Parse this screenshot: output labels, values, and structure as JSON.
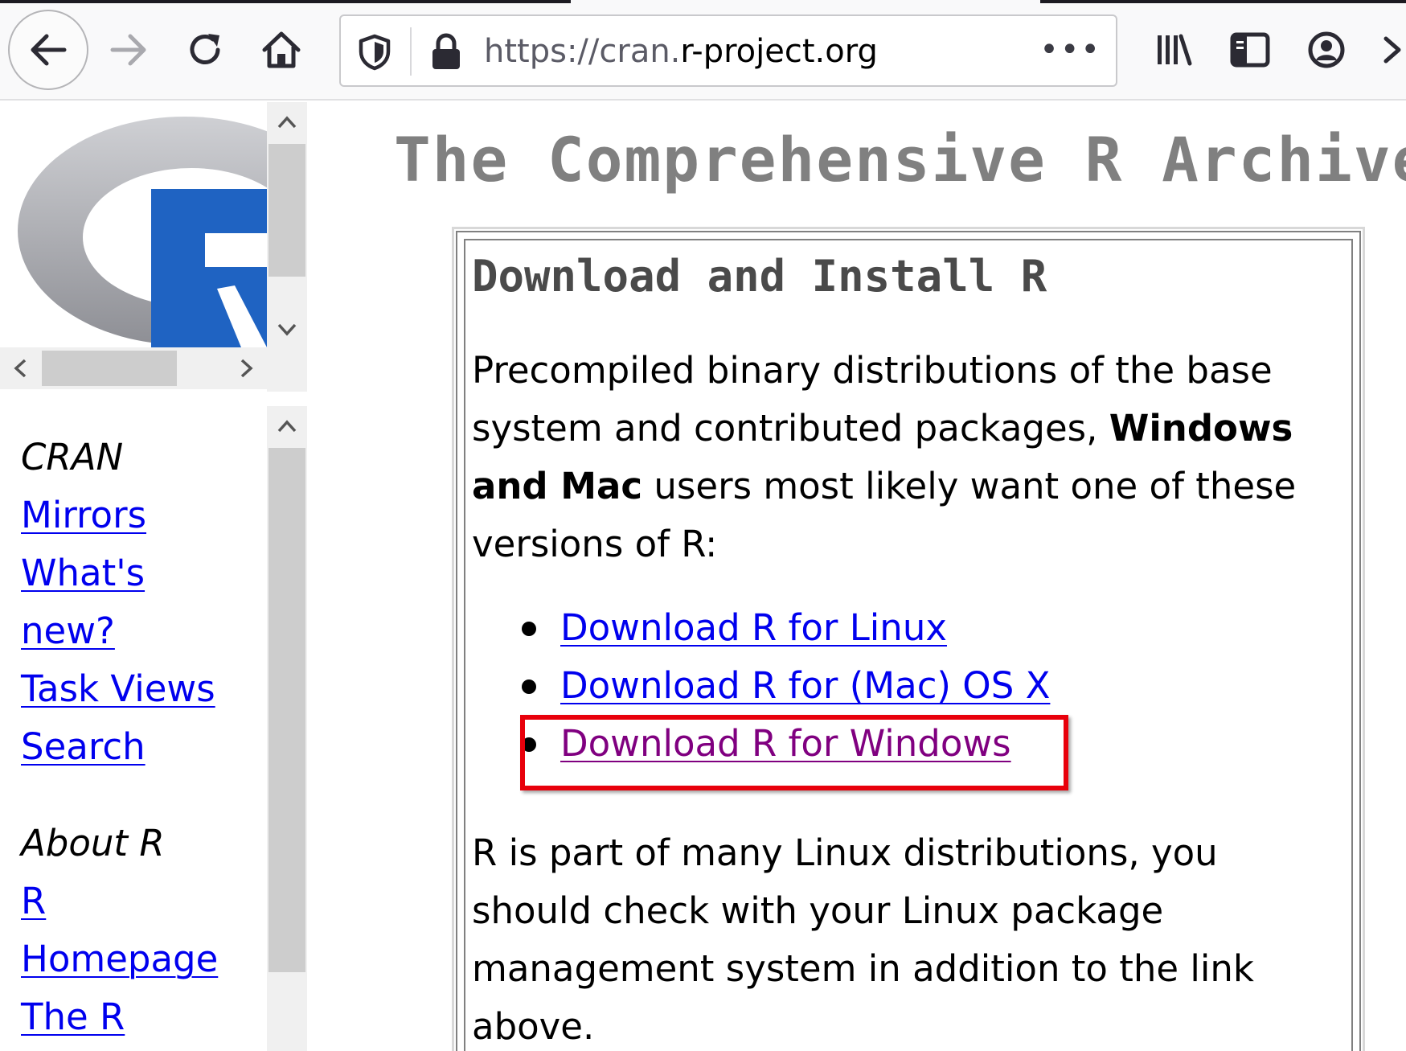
{
  "browser": {
    "url_prefix": "https://cran.",
    "url_domain": "r-project.org",
    "more_label": "•••"
  },
  "icons": {
    "back": "back-arrow-icon",
    "forward": "forward-arrow-icon",
    "reload": "reload-icon",
    "home": "home-icon",
    "tracking": "shield-icon",
    "lock": "lock-icon",
    "library": "library-icon",
    "sidebar": "sidebar-icon",
    "account": "account-icon",
    "overflow": "chevron-right-icon"
  },
  "sidebar": {
    "cran_heading": "CRAN",
    "cran_links": [
      "Mirrors",
      "What's",
      "new?",
      "Task Views",
      "Search"
    ],
    "about_heading": "About R",
    "about_links": [
      "R",
      "Homepage",
      "The R"
    ]
  },
  "main": {
    "title": "The Comprehensive R Archive Network",
    "box_title": "Download and Install R",
    "intro_part1": "Precompiled binary distributions of the base system and contributed packages, ",
    "intro_bold": "Windows and Mac",
    "intro_part2": " users most likely want one of these versions of R:",
    "downloads": [
      {
        "label": "Download R for Linux",
        "visited": false
      },
      {
        "label": "Download R for (Mac) OS X",
        "visited": false
      },
      {
        "label": "Download R for Windows",
        "visited": true
      }
    ],
    "outro": "R is part of many Linux distributions, you should check with your Linux package management system in addition to the link above."
  },
  "colors": {
    "link": "#0000ee",
    "visited_link": "#800080",
    "highlight": "#e8000b",
    "title_gray": "#808080",
    "r_blue": "#1f63c2"
  }
}
